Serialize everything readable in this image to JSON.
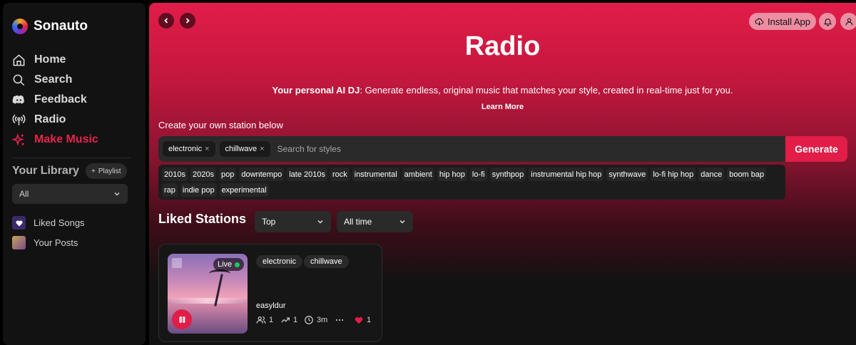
{
  "app": {
    "name": "Sonauto"
  },
  "sidebar": {
    "nav": [
      {
        "label": "Home",
        "icon": "home-icon"
      },
      {
        "label": "Search",
        "icon": "search-icon"
      },
      {
        "label": "Feedback",
        "icon": "discord-icon"
      },
      {
        "label": "Radio",
        "icon": "radio-icon"
      },
      {
        "label": "Make Music",
        "icon": "sparkle-icon",
        "active": true
      }
    ],
    "library_title": "Your Library",
    "playlist_button": "Playlist",
    "filter_value": "All",
    "library_items": [
      {
        "label": "Liked Songs",
        "icon": "heart-icon"
      },
      {
        "label": "Your Posts",
        "icon": "posts-thumbnail"
      }
    ]
  },
  "header": {
    "install_label": "Install App"
  },
  "main": {
    "title": "Radio",
    "tagline_bold": "Your personal AI DJ",
    "tagline_rest": ": Generate endless, original music that matches your style, created in real-time just for you.",
    "learn_more": "Learn More",
    "create_label": "Create your own station below",
    "selected_styles": [
      "electronic",
      "chillwave"
    ],
    "search_placeholder": "Search for styles",
    "generate_label": "Generate",
    "suggestions": [
      "2010s",
      "2020s",
      "pop",
      "downtempo",
      "late 2010s",
      "rock",
      "instrumental",
      "ambient",
      "hip hop",
      "lo-fi",
      "synthpop",
      "instrumental hip hop",
      "synthwave",
      "lo-fi hip hop",
      "dance",
      "boom bap",
      "rap",
      "indie pop",
      "experimental"
    ],
    "liked_title": "Liked Stations",
    "sort_value": "Top",
    "time_value": "All time"
  },
  "station": {
    "live_label": "Live",
    "tags": [
      "electronic",
      "chillwave"
    ],
    "creator": "easyldur",
    "listeners": "1",
    "trend": "1",
    "duration": "3m",
    "likes": "1"
  },
  "colors": {
    "accent": "#e11d48",
    "sidebar_bg": "#121212",
    "live_dot": "#22c55e"
  }
}
